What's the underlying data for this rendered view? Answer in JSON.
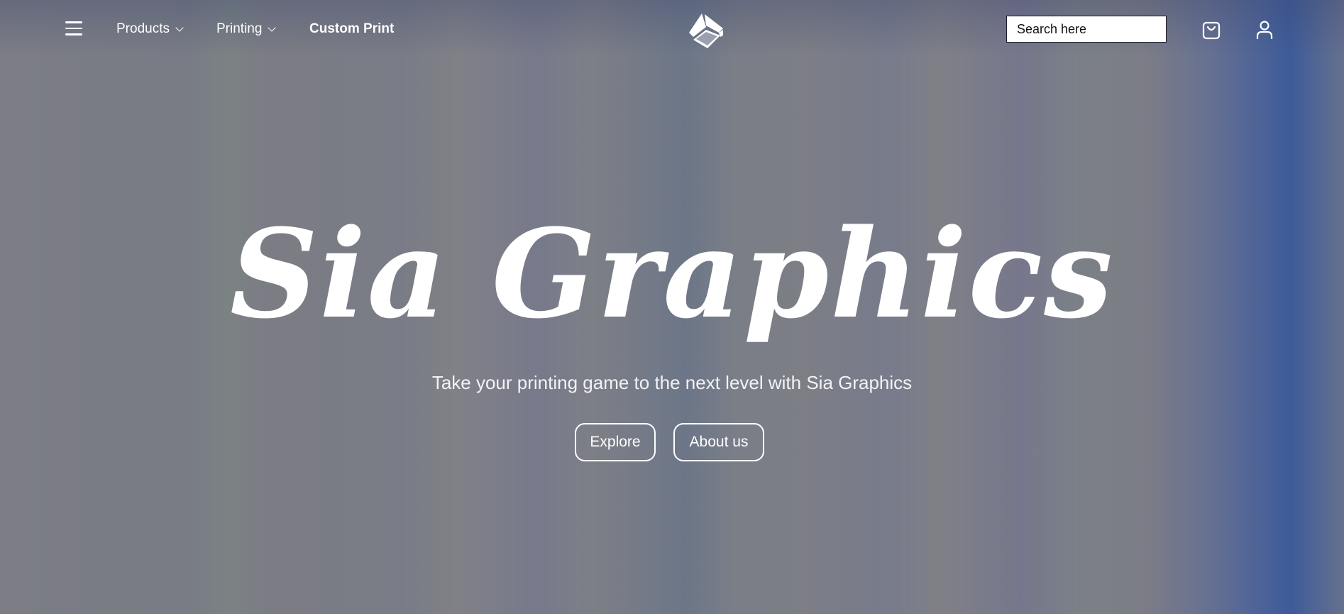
{
  "header": {
    "nav": [
      {
        "label": "Products",
        "dropdown": true
      },
      {
        "label": "Printing",
        "dropdown": true
      },
      {
        "label": "Custom Print",
        "dropdown": false
      }
    ],
    "search": {
      "placeholder": "Search here"
    },
    "icons": {
      "menu": "hamburger-menu-icon",
      "logo": "cube-logo-icon",
      "cart": "shopping-bag-icon",
      "account": "user-icon"
    }
  },
  "hero": {
    "title": "Sia Graphics",
    "subtitle": "Take your printing game to the next level with Sia Graphics",
    "buttons": {
      "explore": "Explore",
      "about": "About us"
    }
  },
  "colors": {
    "text": "#ffffff",
    "background": "#7c7d85",
    "accent_blue": "#2f5aa8"
  }
}
